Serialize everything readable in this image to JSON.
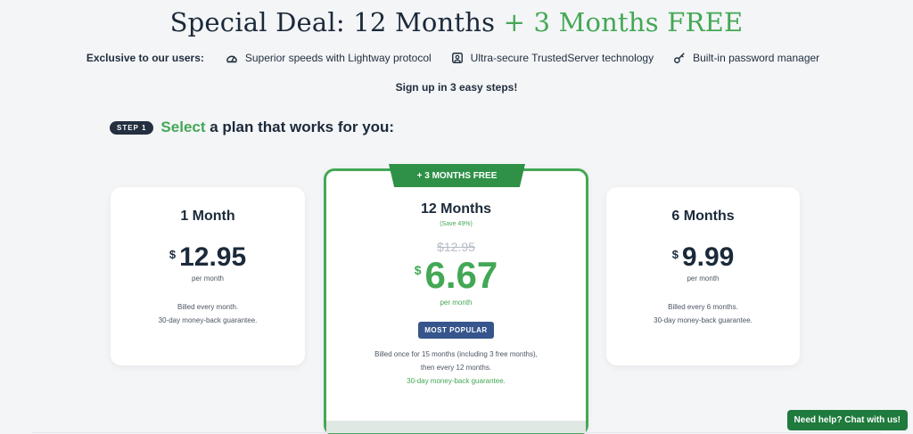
{
  "headline": {
    "main": "Special Deal: 12 Months ",
    "free": "+ 3 Months FREE"
  },
  "features": {
    "lead": "Exclusive to our users:",
    "items": [
      {
        "icon": "speed-icon",
        "label": "Superior speeds with Lightway protocol"
      },
      {
        "icon": "server-shield-icon",
        "label": "Ultra-secure TrustedServer technology"
      },
      {
        "icon": "key-icon",
        "label": "Built-in password manager"
      }
    ]
  },
  "steps_note": "Sign up in 3 easy steps!",
  "step": {
    "pill": "STEP 1",
    "accent": "Select",
    "rest": " a plan that works for you:"
  },
  "plans": {
    "left": {
      "name": "1 Month",
      "currency": "$",
      "price": "12.95",
      "per": "per month",
      "billed1": "Billed every month.",
      "billed2": "30-day money-back guarantee."
    },
    "center": {
      "ribbon": "+ 3 MONTHS FREE",
      "name": "12 Months",
      "save": "(Save 49%)",
      "old": "$12.95",
      "currency": "$",
      "price": "6.67",
      "per": "per month",
      "badge": "MOST POPULAR",
      "billed1": "Billed once for 15 months (including 3 free months),",
      "billed2": "then every 12 months.",
      "guarantee": "30-day money-back guarantee."
    },
    "right": {
      "name": "6 Months",
      "currency": "$",
      "price": "9.99",
      "per": "per month",
      "billed1": "Billed every 6 months.",
      "billed2": "30-day money-back guarantee."
    }
  },
  "chat": "Need help? Chat with us!",
  "colors": {
    "accent": "#43a855",
    "dark": "#1b2a3a",
    "badge": "#36558c"
  }
}
